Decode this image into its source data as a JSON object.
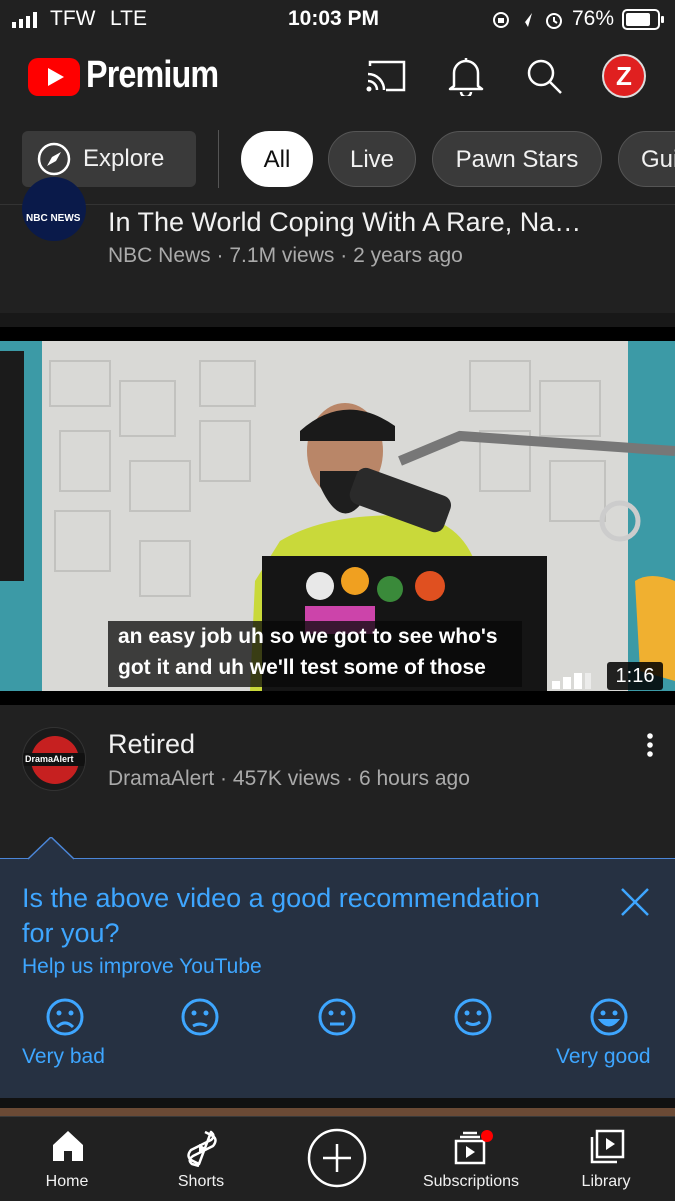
{
  "status_bar": {
    "carrier": "TFW",
    "network": "LTE",
    "time": "10:03 PM",
    "battery": "76%"
  },
  "header": {
    "brand": "Premium",
    "avatar_letter": "Z"
  },
  "chips": {
    "explore": "Explore",
    "items": [
      "All",
      "Live",
      "Pawn Stars",
      "Gui"
    ],
    "active": "All"
  },
  "video_prev": {
    "title": "In The World Coping With A Rare, Na…",
    "channel": "NBC News",
    "views": "7.1M views",
    "age": "2 years ago",
    "avatar_text": "NBC NEWS"
  },
  "video_main": {
    "caption_line1": "an easy job uh so we got to see who's",
    "caption_line2": "got it and uh we'll test some of those",
    "duration": "1:16",
    "title": "Retired",
    "channel": "DramaAlert",
    "views": "457K views",
    "age": "6 hours ago",
    "avatar_text": "DramaAlert"
  },
  "separator": "·",
  "survey": {
    "question_line1": "Is the above video a good recommendation",
    "question_line2": "for you?",
    "subtitle": "Help us improve YouTube",
    "left_label": "Very bad",
    "right_label": "Very good"
  },
  "nav": {
    "items": [
      "Home",
      "Shorts",
      "",
      "Subscriptions",
      "Library"
    ]
  },
  "colors": {
    "accent_blue": "#3ea6ff",
    "youtube_red": "#ff0000",
    "survey_bg": "#263142"
  }
}
